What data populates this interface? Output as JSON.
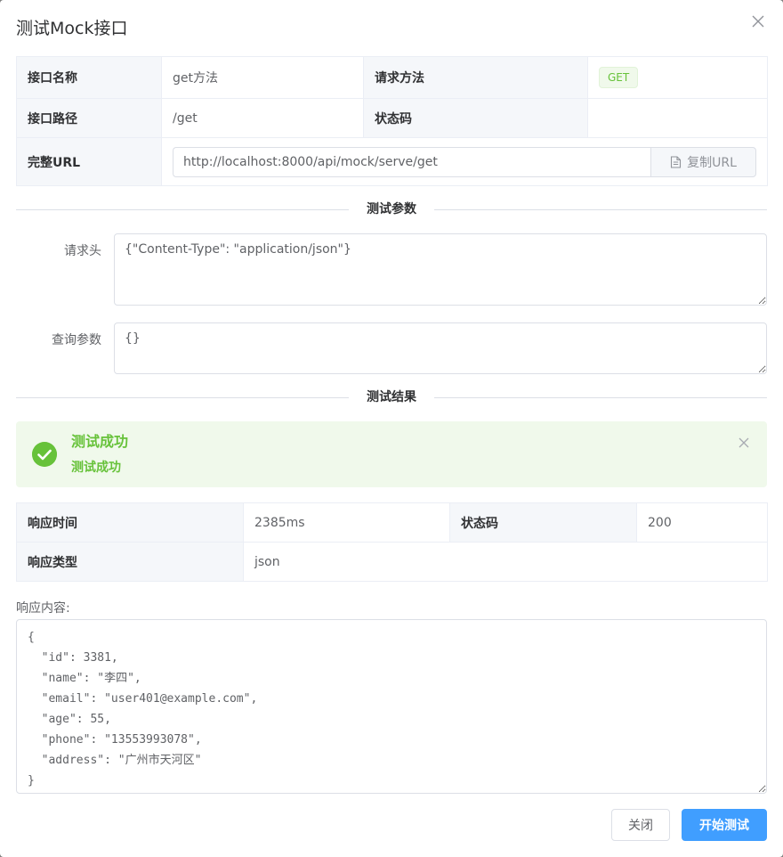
{
  "dialog": {
    "title": "测试Mock接口"
  },
  "info": {
    "name_label": "接口名称",
    "name_value": "get方法",
    "method_label": "请求方法",
    "method_value": "GET",
    "path_label": "接口路径",
    "path_value": "/get",
    "status_label": "状态码",
    "status_value": "",
    "url_label": "完整URL",
    "url_value": "http://localhost:8000/api/mock/serve/get",
    "copy_label": "复制URL"
  },
  "params": {
    "section_title": "测试参数",
    "headers_label": "请求头",
    "headers_value": "{\"Content-Type\": \"application/json\"}",
    "query_label": "查询参数",
    "query_value": "{}"
  },
  "result": {
    "section_title": "测试结果",
    "alert_title": "测试成功",
    "alert_desc": "测试成功",
    "time_label": "响应时间",
    "time_value": "2385ms",
    "status_label": "状态码",
    "status_value": "200",
    "type_label": "响应类型",
    "type_value": "json",
    "content_label": "响应内容:",
    "content_value": "{\n  \"id\": 3381,\n  \"name\": \"李四\",\n  \"email\": \"user401@example.com\",\n  \"age\": 55,\n  \"phone\": \"13553993078\",\n  \"address\": \"广州市天河区\"\n}"
  },
  "footer": {
    "close_label": "关闭",
    "test_label": "开始测试"
  },
  "colors": {
    "primary": "#409eff",
    "success": "#67c23a",
    "success_bg": "#f0f9eb"
  }
}
